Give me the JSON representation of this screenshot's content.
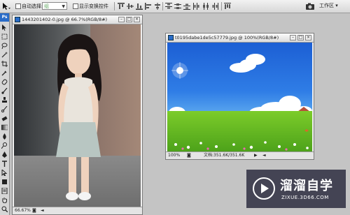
{
  "options_bar": {
    "auto_select_label": "自动选择:",
    "auto_select_value": "组",
    "show_transform_label": "显示变换控件",
    "workspace_label": "工作区 ▾"
  },
  "window_left": {
    "title": "1443201402-0.jpg @ 66.7%(RGB/8#)",
    "zoom": "66.67%"
  },
  "window_right": {
    "title": "t0195dabe1de5c57779.jpg @ 100%(RGB/8#)",
    "zoom": "100%",
    "doc_info": "文档:351.6K/351.6K"
  },
  "watermark": {
    "brand": "溜溜自学",
    "url": "ZIXUE.3D66.COM"
  },
  "colors": {
    "accent": "#2a6cc8",
    "workspace_bg": "#c4c4c4"
  }
}
